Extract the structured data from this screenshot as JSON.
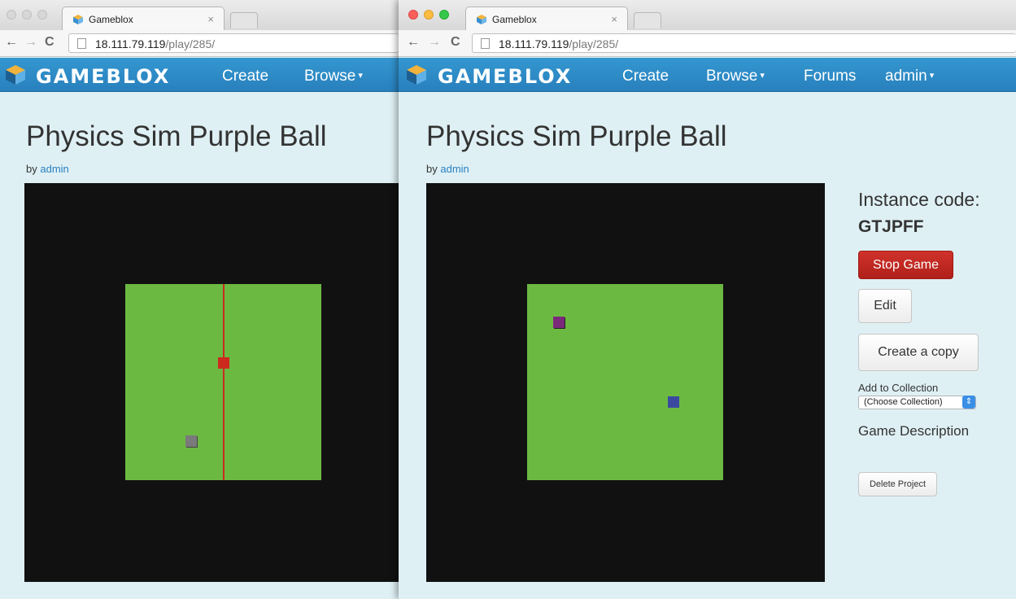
{
  "left_window": {
    "tab": {
      "title": "Gameblox",
      "close": "×"
    },
    "toolbar": {
      "back": "←",
      "forward": "→",
      "reload": "C",
      "url_host": "18.111.79.119",
      "url_path": "/play/285/"
    },
    "navbar": {
      "logo": "GAMEBLOX",
      "links": [
        "Create",
        "Browse"
      ],
      "caret": "▾"
    },
    "page": {
      "title": "Physics Sim Purple Ball",
      "by": "by",
      "author": "admin"
    }
  },
  "right_window": {
    "tab": {
      "title": "Gameblox",
      "close": "×"
    },
    "toolbar": {
      "back": "←",
      "forward": "→",
      "reload": "C",
      "url_host": "18.111.79.119",
      "url_path": "/play/285/"
    },
    "navbar": {
      "logo": "GAMEBLOX",
      "links": [
        "Create",
        "Browse",
        "Forums",
        "admin"
      ],
      "caret": "▾"
    },
    "page": {
      "title": "Physics Sim Purple Ball",
      "by": "by",
      "author": "admin"
    },
    "sidebar": {
      "instance_code_label": "Instance code:",
      "instance_code": "GTJPFF",
      "stop_game": "Stop Game",
      "edit": "Edit",
      "create_copy": "Create a copy",
      "add_to_collection": "Add to Collection",
      "collection_select": "(Choose Collection)",
      "game_description": "Game Description",
      "delete_project": "Delete Project"
    }
  },
  "colors": {
    "navbar": "#2d8bc8",
    "field": "#6cb942",
    "game_bg": "#111111",
    "red_sprite": "#cc2a1f",
    "gray_sprite": "#7a7a7a",
    "purple_sprite": "#7b2a7a",
    "blue_sprite": "#3b4aa0",
    "stop_button": "#c0271f"
  },
  "icons": [
    "gameblox-cube-icon",
    "page-icon",
    "close-icon",
    "back-arrow-icon",
    "forward-arrow-icon",
    "reload-icon",
    "select-arrows-icon"
  ]
}
